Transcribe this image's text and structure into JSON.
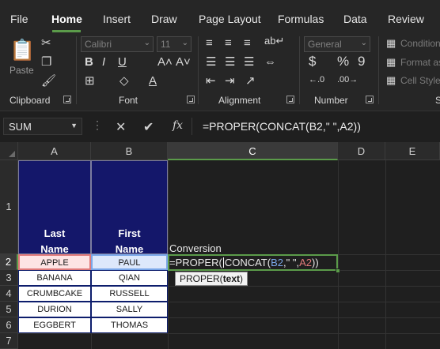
{
  "ribbon": {
    "tabs": [
      "File",
      "Home",
      "Insert",
      "Draw",
      "Page Layout",
      "Formulas",
      "Data",
      "Review"
    ],
    "active_tab": "Home",
    "font_name": "Calibri",
    "font_size": "11",
    "number_format": "General",
    "paste_label": "Paste",
    "styles": [
      "Condition",
      "Format as",
      "Cell Style"
    ],
    "group_labels": {
      "clipboard": "Clipboard",
      "font": "Font",
      "alignment": "Alignment",
      "number": "Number",
      "styles": "S"
    },
    "accent": "#5b9b4a"
  },
  "formula_bar": {
    "name_box": "SUM",
    "formula": "=PROPER(CONCAT(B2,\" \",A2))"
  },
  "grid": {
    "columns": [
      "A",
      "B",
      "C",
      "D",
      "E"
    ],
    "rows": [
      "1",
      "2",
      "3",
      "4",
      "5",
      "6",
      "7"
    ],
    "selected_column": "C",
    "selected_row": "2",
    "headers": {
      "a1_line1": "Last",
      "a1_line2": "Name",
      "b1_line1": "First",
      "b1_line2": "Name",
      "c1": "Conversion"
    },
    "last_names": [
      "APPLE",
      "BANANA",
      "CRUMBCAKE",
      "DURION",
      "EGGBERT"
    ],
    "first_names": [
      "PAUL",
      "QIAN",
      "RUSSELL",
      "SALLY",
      "THOMAS"
    ],
    "header_fill": "#14176a",
    "editing_cell": {
      "fn_proper": "=PROPER(",
      "fn_concat": "CONCAT(",
      "ref_b": "B2",
      "sep1": ",\" \",",
      "ref_a": "A2",
      "close": "))"
    },
    "tooltip": {
      "fn": "PROPER(",
      "arg": "text",
      "close": ")"
    }
  }
}
